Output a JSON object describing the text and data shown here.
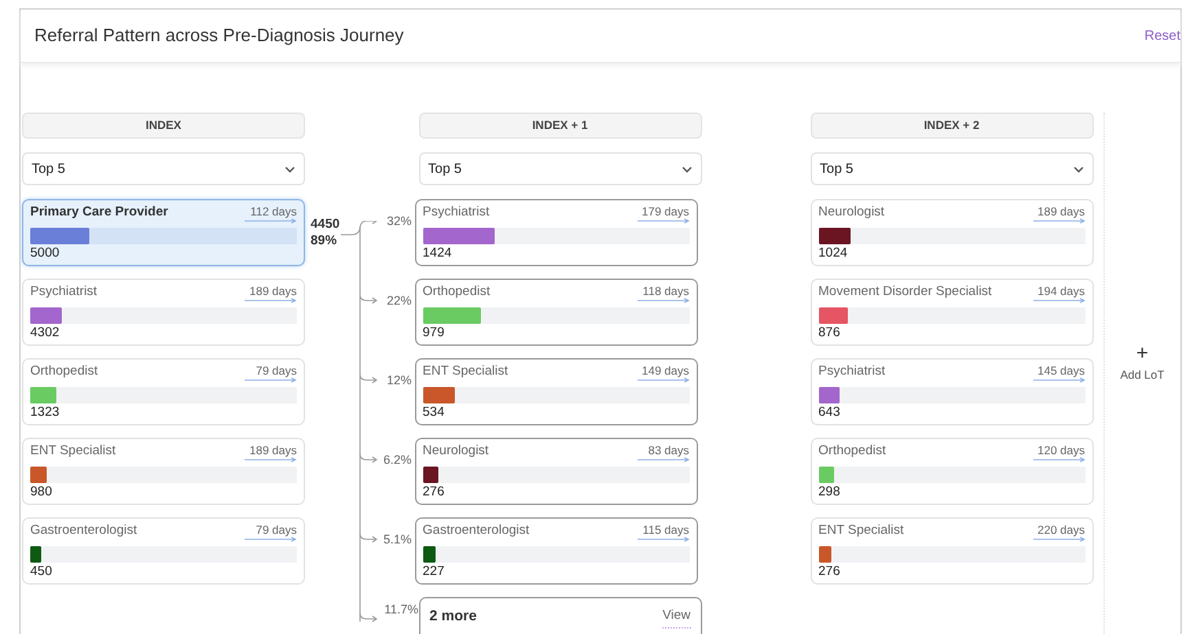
{
  "header": {
    "title": "Referral Pattern across Pre-Diagnosis Journey",
    "reset": "Reset"
  },
  "columns": [
    {
      "heading": "INDEX",
      "dropdown": "Top 5",
      "outlined": false,
      "cards": [
        {
          "name": "Primary Care Provider",
          "days": "112 days",
          "value": "5000",
          "level": 0.22,
          "color": "#6a7fd8",
          "selected": true
        },
        {
          "name": "Psychiatrist",
          "days": "189 days",
          "value": "4302",
          "level": 0.12,
          "color": "#a366cc",
          "selected": false
        },
        {
          "name": "Orthopedist",
          "days": "79 days",
          "value": "1323",
          "level": 0.1,
          "color": "#6acb62",
          "selected": false
        },
        {
          "name": "ENT Specialist",
          "days": "189 days",
          "value": "980",
          "level": 0.06,
          "color": "#c9572a",
          "selected": false
        },
        {
          "name": "Gastroenterologist",
          "days": "79 days",
          "value": "450",
          "level": 0.04,
          "color": "#0d5a12",
          "selected": false
        }
      ]
    },
    {
      "heading": "INDEX + 1",
      "dropdown": "Top 5",
      "outlined": true,
      "cards": [
        {
          "name": "Psychiatrist",
          "days": "179 days",
          "value": "1424",
          "level": 0.27,
          "color": "#a366cc",
          "selected": false
        },
        {
          "name": "Orthopedist",
          "days": "118 days",
          "value": "979",
          "level": 0.22,
          "color": "#6acb62",
          "selected": false
        },
        {
          "name": "ENT Specialist",
          "days": "149 days",
          "value": "534",
          "level": 0.12,
          "color": "#c9572a",
          "selected": false
        },
        {
          "name": "Neurologist",
          "days": "83 days",
          "value": "276",
          "level": 0.06,
          "color": "#6b1422",
          "selected": false
        },
        {
          "name": "Gastroenterologist",
          "days": "115 days",
          "value": "227",
          "level": 0.05,
          "color": "#0d5a12",
          "selected": false
        }
      ]
    },
    {
      "heading": "INDEX + 2",
      "dropdown": "Top 5",
      "outlined": false,
      "cards": [
        {
          "name": "Neurologist",
          "days": "189 days",
          "value": "1024",
          "level": 0.12,
          "color": "#6b1422",
          "selected": false
        },
        {
          "name": "Movement Disorder Specialist",
          "days": "194 days",
          "value": "876",
          "level": 0.11,
          "color": "#e55563",
          "selected": false
        },
        {
          "name": "Psychiatrist",
          "days": "145 days",
          "value": "643",
          "level": 0.08,
          "color": "#a366cc",
          "selected": false
        },
        {
          "name": "Orthopedist",
          "days": "120 days",
          "value": "298",
          "level": 0.06,
          "color": "#6acb62",
          "selected": false
        },
        {
          "name": "ENT Specialist",
          "days": "220 days",
          "value": "276",
          "level": 0.05,
          "color": "#c9572a",
          "selected": false
        }
      ]
    }
  ],
  "connector": {
    "count": "4450",
    "share": "89%",
    "branches": [
      "32%",
      "22%",
      "12%",
      "6.2%",
      "5.1%",
      "11.7%"
    ]
  },
  "more_card": {
    "label": "2 more",
    "link": "View"
  },
  "add_button": {
    "icon": "+",
    "label": "Add LoT"
  }
}
